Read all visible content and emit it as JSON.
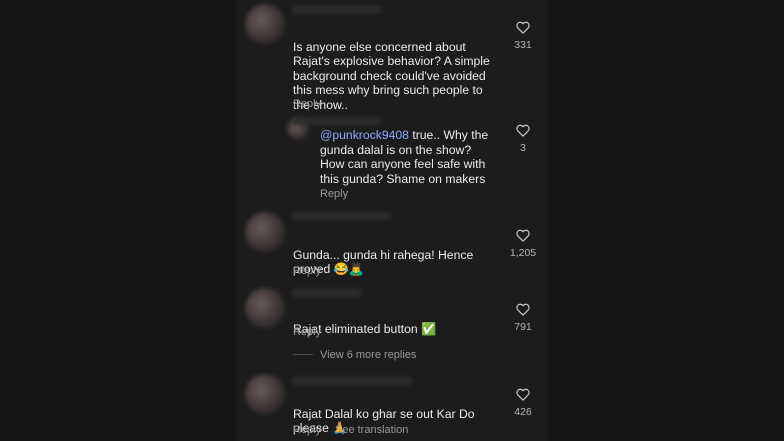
{
  "comments": [
    {
      "text_lines": [
        "Is anyone else concerned about",
        "Rajat's explosive behavior? A simple",
        "background check could've avoided",
        "this mess why bring such people to",
        "the show.."
      ],
      "reply_label": "Reply",
      "likes": "331",
      "heart_icon": "heart-outline-icon"
    },
    {
      "mention": "@punkrock9408",
      "text_lines": [
        " true.. Why the",
        "gunda dalal is on the show?",
        "How can anyone feel safe with",
        "this gunda? Shame on makers"
      ],
      "reply_label": "Reply",
      "likes": "3",
      "heart_icon": "heart-outline-icon"
    },
    {
      "text_lines": [
        "Gunda... gunda hi rahega! Hence",
        "proved 😂🙇‍♂️"
      ],
      "reply_label": "Reply",
      "likes": "1,205",
      "heart_icon": "heart-outline-icon"
    },
    {
      "text_lines": [
        "Rajat eliminated button ✅"
      ],
      "reply_label": "Reply",
      "likes": "791",
      "heart_icon": "heart-outline-icon",
      "view_replies": "View 6 more replies"
    },
    {
      "text_lines": [
        "Rajat Dalal ko ghar se out Kar Do",
        "please 🙏"
      ],
      "reply_label": "Reply",
      "see_translation": "See translation",
      "likes": "426",
      "heart_icon": "heart-outline-icon"
    }
  ]
}
